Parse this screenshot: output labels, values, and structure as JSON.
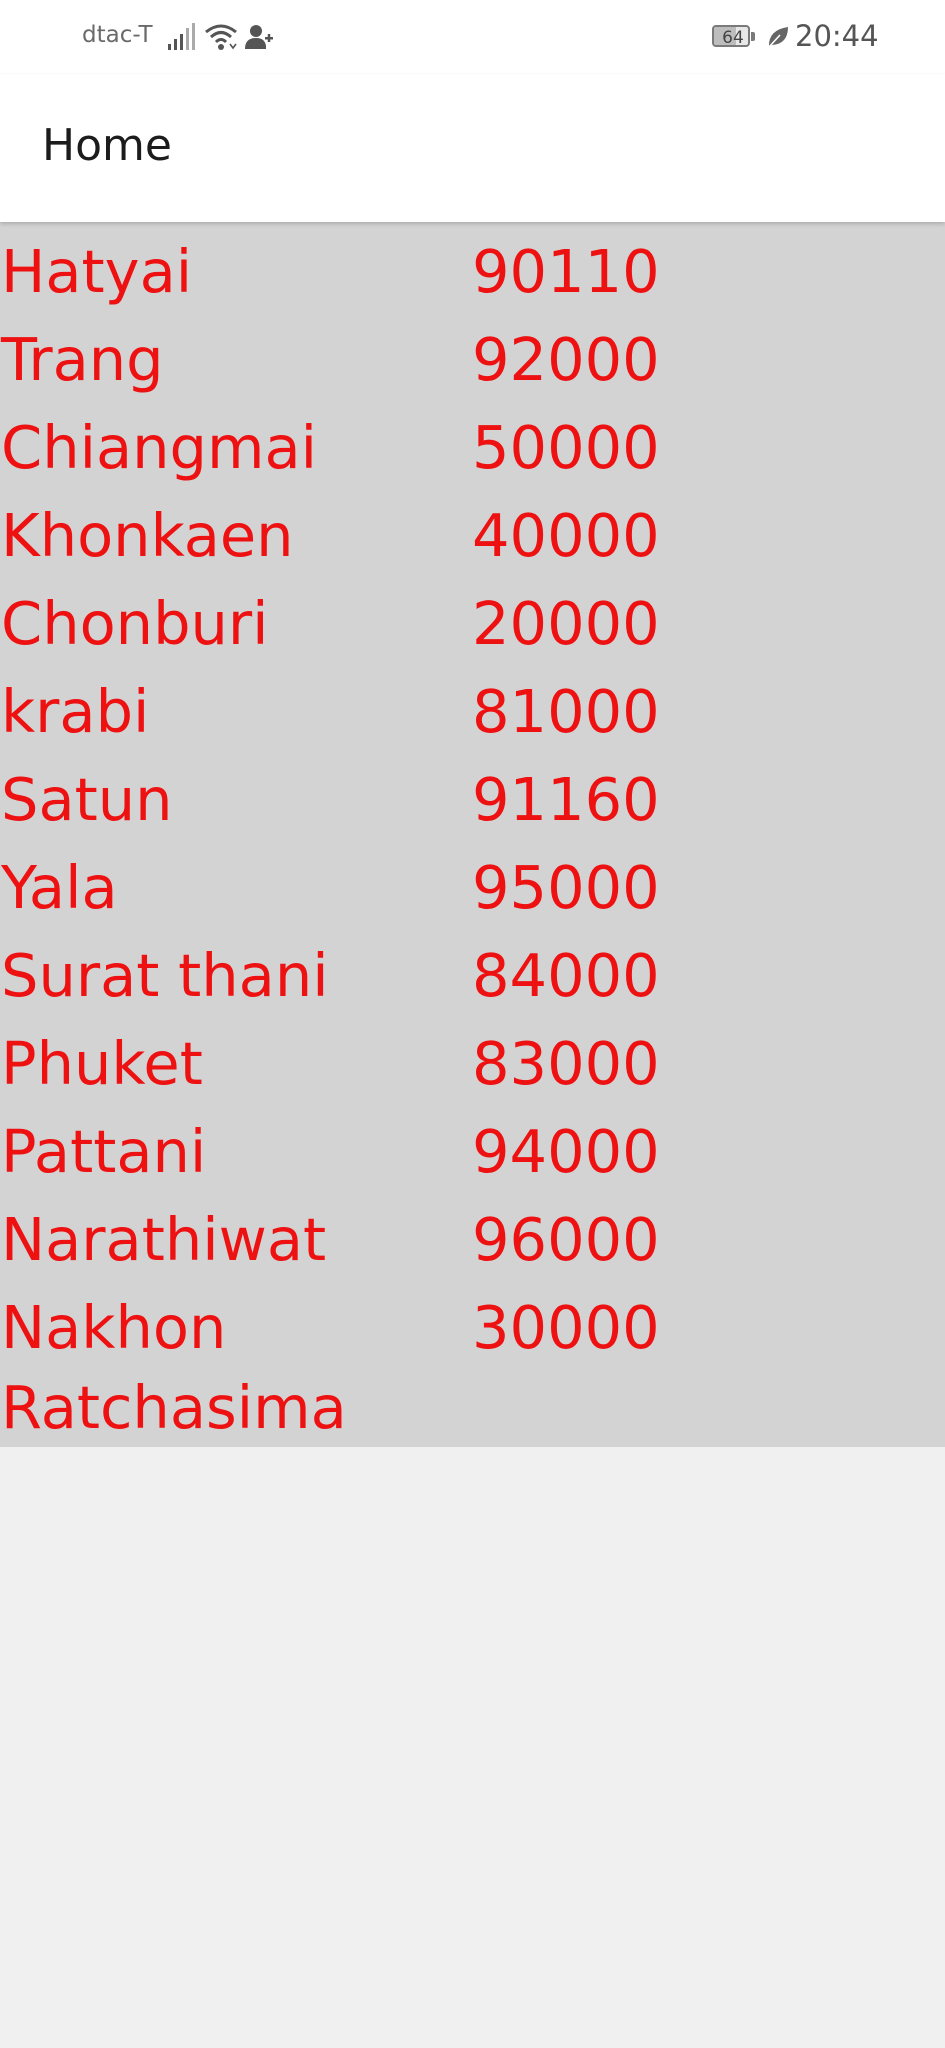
{
  "status_bar": {
    "carrier": "dtac-T",
    "battery_level": "64",
    "battery_fraction": 0.64,
    "time": "20:44",
    "icons": [
      "signal-icon",
      "wifi-icon",
      "user-add-icon",
      "battery-icon",
      "leaf-icon"
    ]
  },
  "app_bar": {
    "title": "Home"
  },
  "colors": {
    "text_red": "#ee1111",
    "list_bg": "#d3d3d3",
    "page_bg": "#f0f0f0"
  },
  "list": {
    "items": [
      {
        "city": "Hatyai",
        "zip": "90110"
      },
      {
        "city": "Trang",
        "zip": "92000"
      },
      {
        "city": "Chiangmai",
        "zip": "50000"
      },
      {
        "city": "Khonkaen",
        "zip": "40000"
      },
      {
        "city": "Chonburi",
        "zip": "20000"
      },
      {
        "city": "krabi",
        "zip": "81000"
      },
      {
        "city": "Satun",
        "zip": "91160"
      },
      {
        "city": "Yala",
        "zip": "95000"
      },
      {
        "city": "Surat thani",
        "zip": "84000"
      },
      {
        "city": "Phuket",
        "zip": "83000"
      },
      {
        "city": "Pattani",
        "zip": "94000"
      },
      {
        "city": "Narathiwat",
        "zip": "96000"
      },
      {
        "city": "Nakhon Ratchasima",
        "zip": "30000"
      }
    ]
  }
}
